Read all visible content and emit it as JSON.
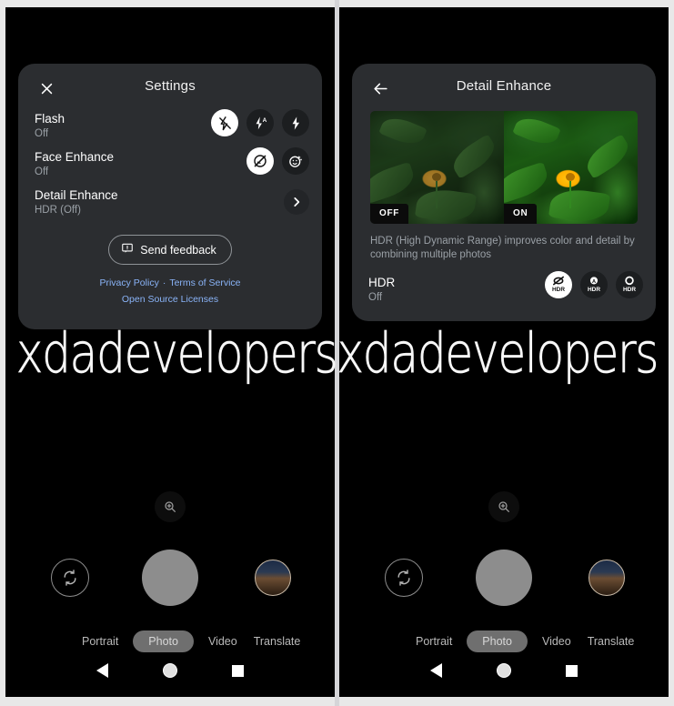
{
  "watermark": {
    "text": "xdadevelopersxdadevelopers"
  },
  "colors": {
    "sheet_bg": "#2b2d30",
    "link": "#8ab4f8",
    "subtext": "#9aa0a6",
    "shutter": "#8d8d8d",
    "selected_option": "#ffffff",
    "phone_bg": "#000000"
  },
  "left_panel": {
    "sheet": {
      "title": "Settings",
      "close_icon": "close-icon",
      "rows": [
        {
          "label": "Flash",
          "value": "Off",
          "options": [
            {
              "icon": "flash-off-icon",
              "selected": true
            },
            {
              "icon": "flash-auto-icon",
              "selected": false
            },
            {
              "icon": "flash-on-icon",
              "selected": false
            }
          ]
        },
        {
          "label": "Face Enhance",
          "value": "Off",
          "options": [
            {
              "icon": "face-enhance-off-icon",
              "selected": true
            },
            {
              "icon": "face-enhance-on-icon",
              "selected": false
            }
          ]
        },
        {
          "label": "Detail Enhance",
          "value": "HDR (Off)",
          "options": [
            {
              "icon": "chevron-right-icon",
              "selected": false
            }
          ]
        }
      ],
      "feedback": {
        "label": "Send feedback",
        "icon": "feedback-icon"
      },
      "links": {
        "privacy": "Privacy Policy",
        "separator": "·",
        "terms": "Terms of Service",
        "licenses": "Open Source Licenses"
      }
    },
    "camera": {
      "zoom_icon": "zoom-in-icon",
      "flip_icon": "switch-camera-icon",
      "shutter_label": "shutter-button",
      "thumbnail_label": "last-photo-thumbnail",
      "modes": [
        {
          "label": "Portrait",
          "active": false
        },
        {
          "label": "Photo",
          "active": true
        },
        {
          "label": "Video",
          "active": false
        },
        {
          "label": "Translate",
          "active": false
        }
      ],
      "navbar": [
        {
          "icon": "android-back-icon"
        },
        {
          "icon": "android-home-icon"
        },
        {
          "icon": "android-recents-icon"
        }
      ]
    }
  },
  "right_panel": {
    "sheet": {
      "title": "Detail Enhance",
      "back_icon": "back-arrow-icon",
      "preview": {
        "left_tag": "OFF",
        "right_tag": "ON"
      },
      "description": "HDR (High Dynamic Range) improves color and detail by combining multiple photos",
      "row": {
        "label": "HDR",
        "value": "Off",
        "options": [
          {
            "icon": "hdr-off-icon",
            "label": "HDR",
            "selected": true
          },
          {
            "icon": "hdr-auto-icon",
            "label": "HDR",
            "selected": false
          },
          {
            "icon": "hdr-on-icon",
            "label": "HDR",
            "selected": false
          }
        ]
      }
    },
    "camera": {
      "zoom_icon": "zoom-in-icon",
      "flip_icon": "switch-camera-icon",
      "shutter_label": "shutter-button",
      "thumbnail_label": "last-photo-thumbnail",
      "modes": [
        {
          "label": "Portrait",
          "active": false
        },
        {
          "label": "Photo",
          "active": true
        },
        {
          "label": "Video",
          "active": false
        },
        {
          "label": "Translate",
          "active": false
        }
      ],
      "navbar": [
        {
          "icon": "android-back-icon"
        },
        {
          "icon": "android-home-icon"
        },
        {
          "icon": "android-recents-icon"
        }
      ]
    }
  }
}
